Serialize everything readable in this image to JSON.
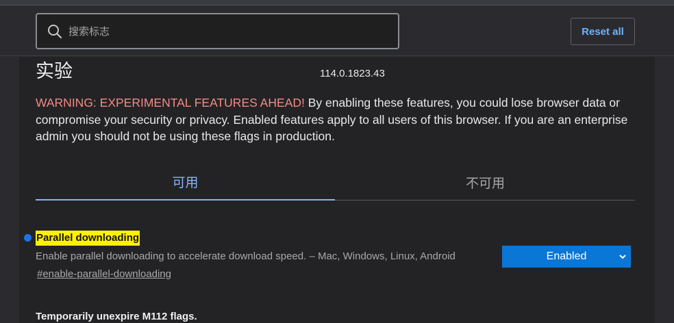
{
  "header": {
    "search": {
      "placeholder": "搜索标志",
      "value": ""
    },
    "reset_label": "Reset all"
  },
  "page": {
    "title": "实验",
    "version": "114.0.1823.43",
    "warning_label": "WARNING: EXPERIMENTAL FEATURES AHEAD!",
    "warning_text": " By enabling these features, you could lose browser data or compromise your security or privacy. Enabled features apply to all users of this browser. If you are an enterprise admin you should not be using these flags in production."
  },
  "tabs": [
    {
      "label": "可用",
      "active": true
    },
    {
      "label": "不可用",
      "active": false
    }
  ],
  "flags": [
    {
      "title": "Parallel downloading",
      "description": "Enable parallel downloading to accelerate download speed. – Mac, Windows, Linux, Android",
      "link": "#enable-parallel-downloading",
      "state": "Enabled"
    },
    {
      "title": "Temporarily unexpire M112 flags."
    }
  ],
  "colors": {
    "accent": "#8ab4f8",
    "warning": "#f28b82",
    "highlight": "#fff200",
    "select_bg": "#0a77d6"
  }
}
